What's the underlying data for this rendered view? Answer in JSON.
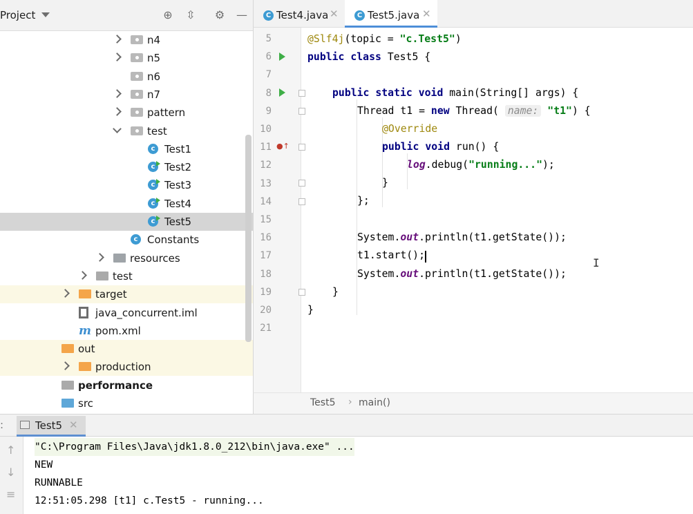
{
  "project_panel": {
    "title": "Project",
    "tree": [
      {
        "label": "n4",
        "icon": "package-icon",
        "expander": "closed",
        "indent": 1
      },
      {
        "label": "n5",
        "icon": "package-icon",
        "expander": "closed",
        "indent": 1
      },
      {
        "label": "n6",
        "icon": "package-icon",
        "expander": "none",
        "indent": 1
      },
      {
        "label": "n7",
        "icon": "package-icon",
        "expander": "closed",
        "indent": 1
      },
      {
        "label": "pattern",
        "icon": "package-icon",
        "expander": "closed",
        "indent": 1
      },
      {
        "label": "test",
        "icon": "package-icon",
        "expander": "open",
        "indent": 1
      },
      {
        "label": "Test1",
        "icon": "class-icon",
        "expander": "none",
        "indent": 2
      },
      {
        "label": "Test2",
        "icon": "runnable-class-icon",
        "expander": "none",
        "indent": 2
      },
      {
        "label": "Test3",
        "icon": "runnable-class-icon",
        "expander": "none",
        "indent": 2
      },
      {
        "label": "Test4",
        "icon": "runnable-class-icon",
        "expander": "none",
        "indent": 2
      },
      {
        "label": "Test5",
        "icon": "runnable-class-icon",
        "expander": "none",
        "indent": 2
      },
      {
        "label": "Constants",
        "icon": "class-icon",
        "expander": "none",
        "indent": 1
      },
      {
        "label": "resources",
        "icon": "resources-folder-icon",
        "expander": "closed",
        "indent": 0
      },
      {
        "label": "test",
        "icon": "folder-icon",
        "expander": "closed",
        "indent": -1
      },
      {
        "label": "target",
        "icon": "excluded-folder-icon",
        "expander": "closed",
        "indent": -2
      },
      {
        "label": "java_concurrent.iml",
        "icon": "iml-file-icon",
        "expander": "none",
        "indent": -2
      },
      {
        "label": "pom.xml",
        "icon": "maven-icon",
        "expander": "none",
        "indent": -2
      },
      {
        "label": "out",
        "icon": "excluded-folder-icon",
        "expander": "none",
        "indent": -3
      },
      {
        "label": "production",
        "icon": "excluded-folder-icon",
        "expander": "closed",
        "indent": -2
      },
      {
        "label": "performance",
        "icon": "module-folder-icon",
        "expander": "none",
        "indent": -3
      },
      {
        "label": "src",
        "icon": "source-folder-icon",
        "expander": "none",
        "indent": -3
      }
    ]
  },
  "editor": {
    "tabs": [
      {
        "label": "Test4.java",
        "active": false
      },
      {
        "label": "Test5.java",
        "active": true
      }
    ],
    "line_numbers": [
      "5",
      "6",
      "7",
      "8",
      "9",
      "10",
      "11",
      "12",
      "13",
      "14",
      "15",
      "16",
      "17",
      "18",
      "19",
      "20",
      "21"
    ],
    "inlay_hint": "name:",
    "breadcrumb": [
      "Test5",
      "main()"
    ],
    "breadcrumb_separator": "›"
  },
  "run_panel": {
    "tab_label": "Test5",
    "console_lines": [
      "\"C:\\Program Files\\Java\\jdk1.8.0_212\\bin\\java.exe\" ...",
      "NEW",
      "RUNNABLE",
      "12:51:05.298 [t1] c.Test5 - running..."
    ]
  }
}
